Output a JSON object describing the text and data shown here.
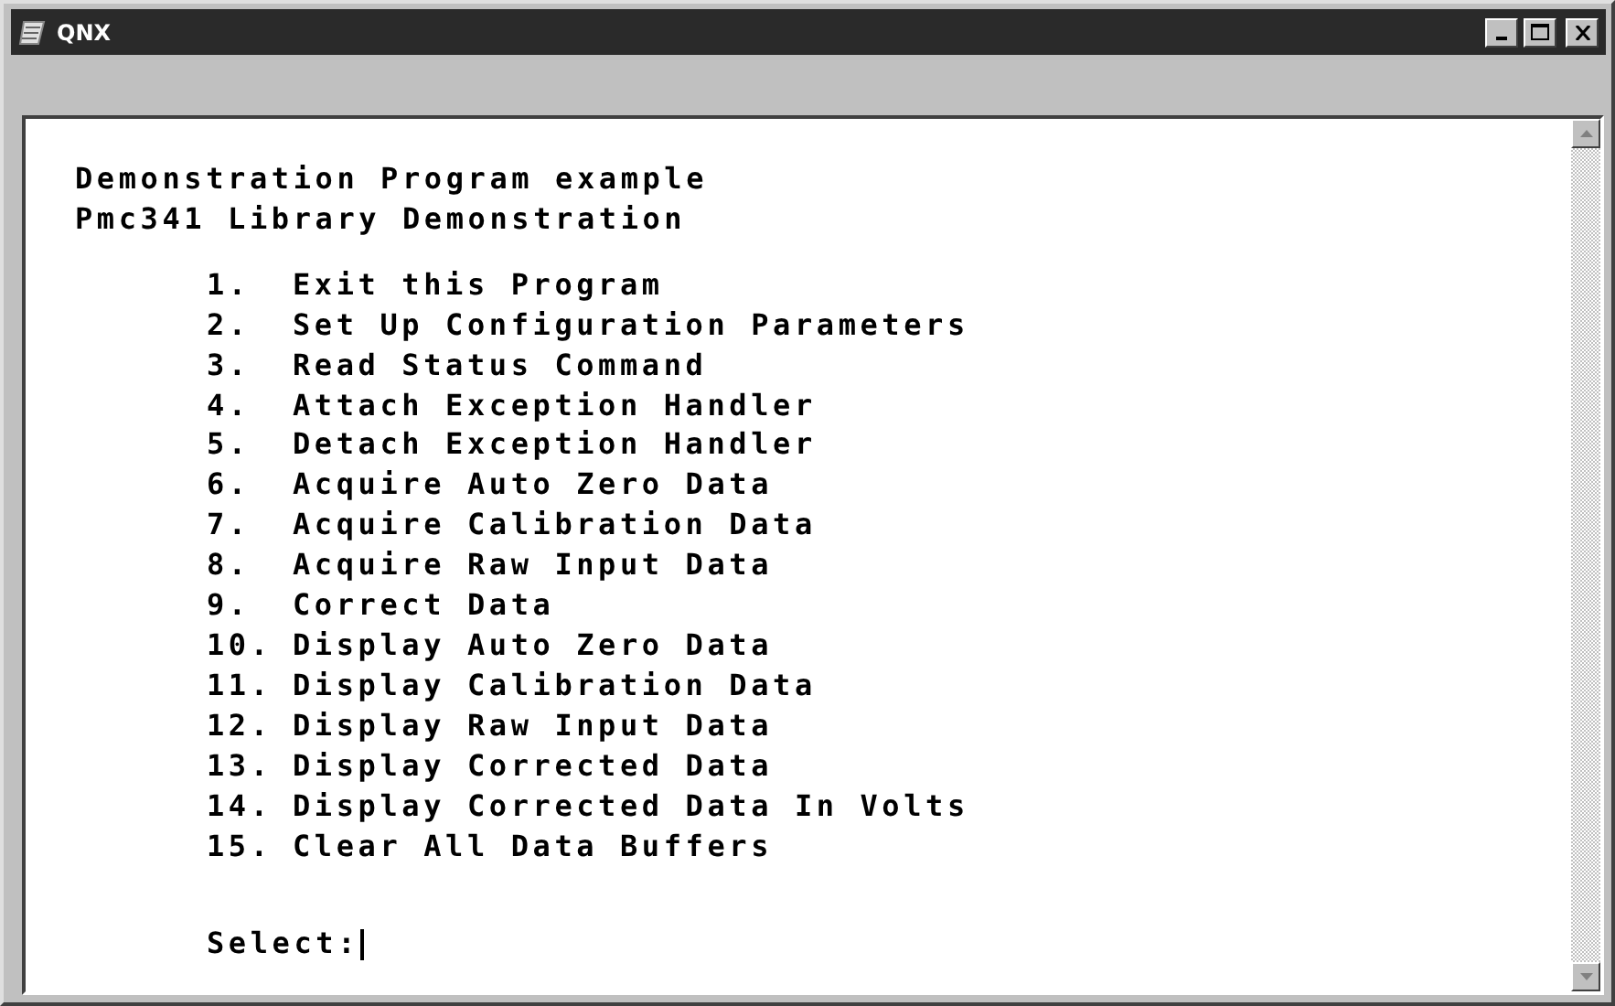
{
  "window": {
    "title": "QNX"
  },
  "terminal": {
    "header_lines": [
      "Demonstration Program example",
      "Pmc341 Library Demonstration"
    ],
    "menu_items": [
      {
        "number": "1.",
        "label": "Exit this Program"
      },
      {
        "number": "2.",
        "label": "Set Up Configuration Parameters"
      },
      {
        "number": "3.",
        "label": "Read Status Command"
      },
      {
        "number": "4.",
        "label": "Attach Exception Handler"
      },
      {
        "number": "5.",
        "label": "Detach Exception Handler"
      },
      {
        "number": "6.",
        "label": "Acquire Auto Zero Data"
      },
      {
        "number": "7.",
        "label": "Acquire Calibration Data"
      },
      {
        "number": "8.",
        "label": "Acquire Raw Input Data"
      },
      {
        "number": "9.",
        "label": "Correct Data"
      },
      {
        "number": "10.",
        "label": "Display Auto Zero Data"
      },
      {
        "number": "11.",
        "label": "Display Calibration Data"
      },
      {
        "number": "12.",
        "label": "Display Raw Input Data"
      },
      {
        "number": "13.",
        "label": "Display Corrected Data"
      },
      {
        "number": "14.",
        "label": "Display Corrected Data In Volts"
      },
      {
        "number": "15.",
        "label": "Clear All Data Buffers"
      }
    ],
    "prompt": "Select:"
  }
}
